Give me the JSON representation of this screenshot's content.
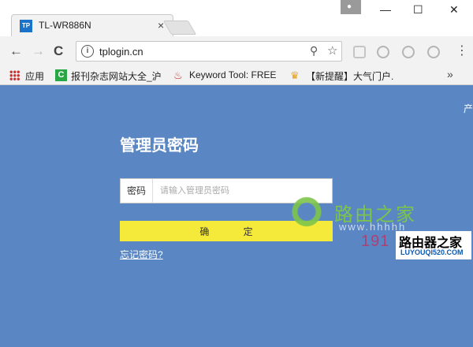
{
  "browser": {
    "tab": {
      "favicon": "TP",
      "title": "TL-WR886N",
      "close_icon": "×"
    },
    "window_controls": {
      "minimize": "—",
      "maximize": "☐",
      "close": "✕"
    },
    "nav": {
      "back": "←",
      "forward": "→",
      "reload": "C"
    },
    "url": "tplogin.cn",
    "bookmarks": [
      {
        "label": "应用",
        "icon": "apps-icon"
      },
      {
        "label": "报刊杂志网站大全_沪",
        "icon": "green-c-icon"
      },
      {
        "label": "Keyword Tool: FREE",
        "icon": "flame-icon"
      },
      {
        "label": "【新提醒】大气门户.",
        "icon": "trophy-icon"
      }
    ],
    "bookmarks_more": "»"
  },
  "page": {
    "corner_text": "产",
    "title": "管理员密码",
    "password_label": "密码",
    "password_placeholder": "请输入管理员密码",
    "confirm_button": "确 定",
    "forgot_link": "忘记密码?"
  },
  "watermark": {
    "name": "路由之家",
    "url": "www.hhhhh",
    "number": "191",
    "box_title": "路由器之家",
    "box_sub": "LUYOUQI520.COM"
  },
  "colors": {
    "page_bg": "#5a87c4",
    "button": "#f5e93a",
    "accent_green": "#7dc44a"
  }
}
